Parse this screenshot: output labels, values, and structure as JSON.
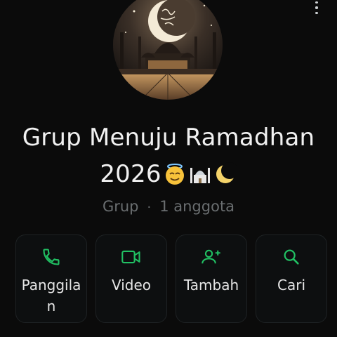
{
  "header": {
    "menu_icon": "more-vertical-icon"
  },
  "group": {
    "name_line1": "Grup Menuju Ramadhan",
    "name_line2": "2026",
    "name_emojis": [
      "smiling-face-with-halo-emoji",
      "mosque-emoji",
      "crescent-moon-emoji"
    ],
    "type_label": "Grup",
    "separator": "·",
    "member_count": "1 anggota"
  },
  "avatar": {
    "icon": "mosque-crescent-calligraphy-image"
  },
  "actions": [
    {
      "label": "Panggilan",
      "icon": "phone-icon"
    },
    {
      "label": "Video",
      "icon": "video-camera-icon"
    },
    {
      "label": "Tambah",
      "icon": "add-person-icon"
    },
    {
      "label": "Cari",
      "icon": "search-icon"
    }
  ],
  "colors": {
    "background": "#0b0b0b",
    "accent_green": "#21c063",
    "muted_text": "#6a6e70",
    "card_border": "#1e2224"
  }
}
